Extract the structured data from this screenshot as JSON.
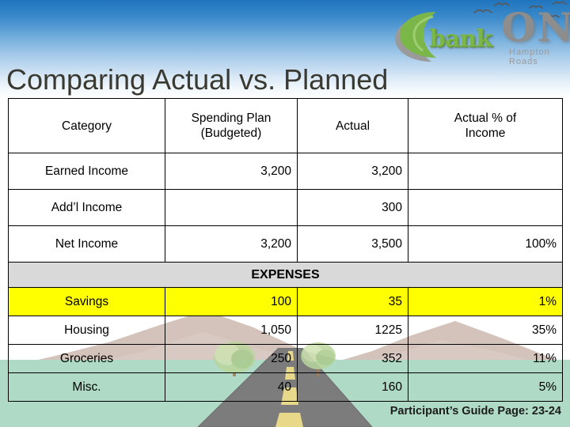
{
  "slide": {
    "title": "Comparing Actual vs. Planned",
    "footer": "Participant’s Guide Page: 23-24"
  },
  "logo": {
    "crescent_icon": "crescent-moon-icon",
    "birds_icon": "flying-birds-icon",
    "word_bank": "bank",
    "word_on": "ON",
    "tagline": "Hampton Roads",
    "green": "#7ab648",
    "gray": "#8d8d8d"
  },
  "table": {
    "headers": [
      "Category",
      "Spending Plan (Budgeted)",
      "Actual",
      "Actual % of Income"
    ],
    "header_lines": {
      "category": "Category",
      "plan_line1": "Spending Plan",
      "plan_line2": "(Budgeted)",
      "actual": "Actual",
      "pct_line1": "Actual % of",
      "pct_line2": "Income"
    },
    "income_rows": [
      {
        "category": "Earned Income",
        "plan": "3,200",
        "actual": "3,200",
        "pct": ""
      },
      {
        "category": "Add’l Income",
        "plan": "",
        "actual": "300",
        "pct": ""
      },
      {
        "category": "Net Income",
        "plan": "3,200",
        "actual": "3,500",
        "pct": "100%"
      }
    ],
    "section_label": "EXPENSES",
    "expense_rows": [
      {
        "category": "Savings",
        "plan": "100",
        "actual": "35",
        "pct": "1%",
        "highlight": true
      },
      {
        "category": "Housing",
        "plan": "1,050",
        "actual": "1225",
        "pct": "35%",
        "highlight": false
      },
      {
        "category": "Groceries",
        "plan": "250",
        "actual": "352",
        "pct": "11%",
        "highlight": false
      },
      {
        "category": "Misc.",
        "plan": "40",
        "actual": "160",
        "pct": "5%",
        "highlight": false
      }
    ],
    "highlight_color": "#ffff00",
    "section_bg": "#d9d9d9"
  },
  "background": {
    "sky_top": "#1f74bd",
    "field": "#aedac6",
    "mountain": "#d4c3bb",
    "road": "#7a7a7a",
    "road_line": "#e8d98a"
  }
}
